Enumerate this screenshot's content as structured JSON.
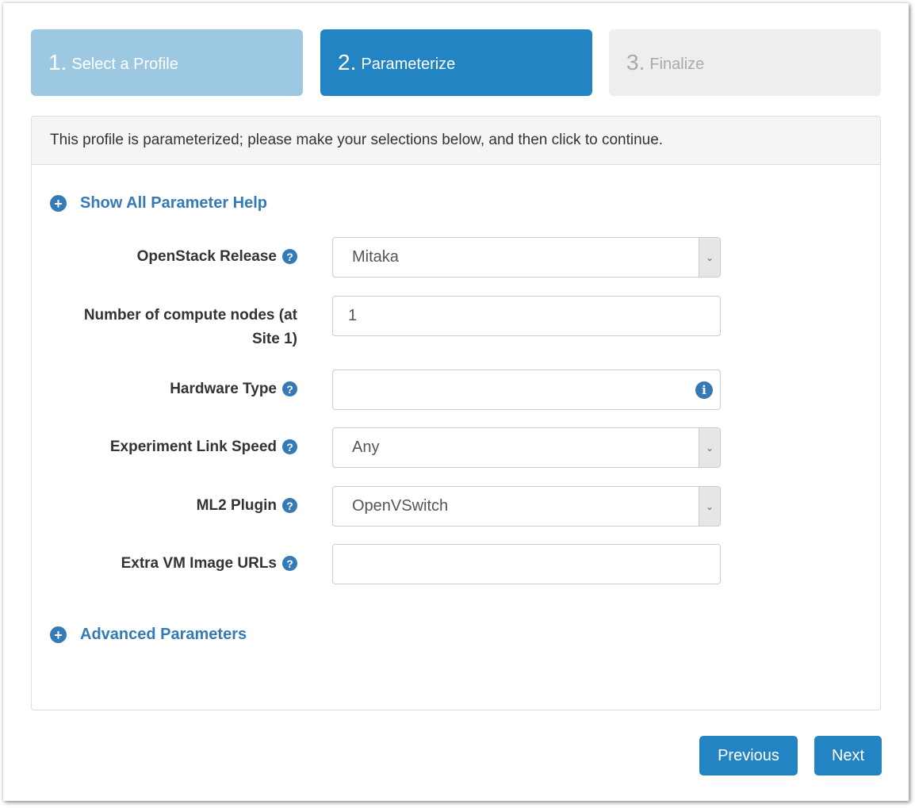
{
  "steps": [
    {
      "number": "1.",
      "label": "Select a Profile",
      "state": "completed"
    },
    {
      "number": "2.",
      "label": "Parameterize",
      "state": "active"
    },
    {
      "number": "3.",
      "label": "Finalize",
      "state": "disabled"
    }
  ],
  "panel": {
    "heading": "This profile is parameterized; please make your selections below, and then click to continue.",
    "show_help_label": "Show All Parameter Help",
    "advanced_label": "Advanced Parameters",
    "toggle_icon": "+",
    "help_icon": "?",
    "info_icon": "i",
    "select_arrow_icon": "⌄"
  },
  "fields": [
    {
      "label": "OpenStack Release",
      "type": "select",
      "value": "Mitaka",
      "has_help": true
    },
    {
      "label": "Number of compute nodes (at Site 1)",
      "type": "input",
      "value": "1",
      "has_help": false
    },
    {
      "label": "Hardware Type",
      "type": "input",
      "value": "",
      "has_help": true,
      "has_info": true
    },
    {
      "label": "Experiment Link Speed",
      "type": "select",
      "value": "Any",
      "has_help": true
    },
    {
      "label": "ML2 Plugin",
      "type": "select",
      "value": "OpenVSwitch",
      "has_help": true
    },
    {
      "label": "Extra VM Image URLs",
      "type": "input",
      "value": "",
      "has_help": true
    }
  ],
  "buttons": {
    "previous": "Previous",
    "next": "Next"
  },
  "colors": {
    "primary": "#2284c2",
    "link": "#337ab7",
    "step_completed": "#9dc8e2",
    "step_disabled": "#eeeeee"
  }
}
